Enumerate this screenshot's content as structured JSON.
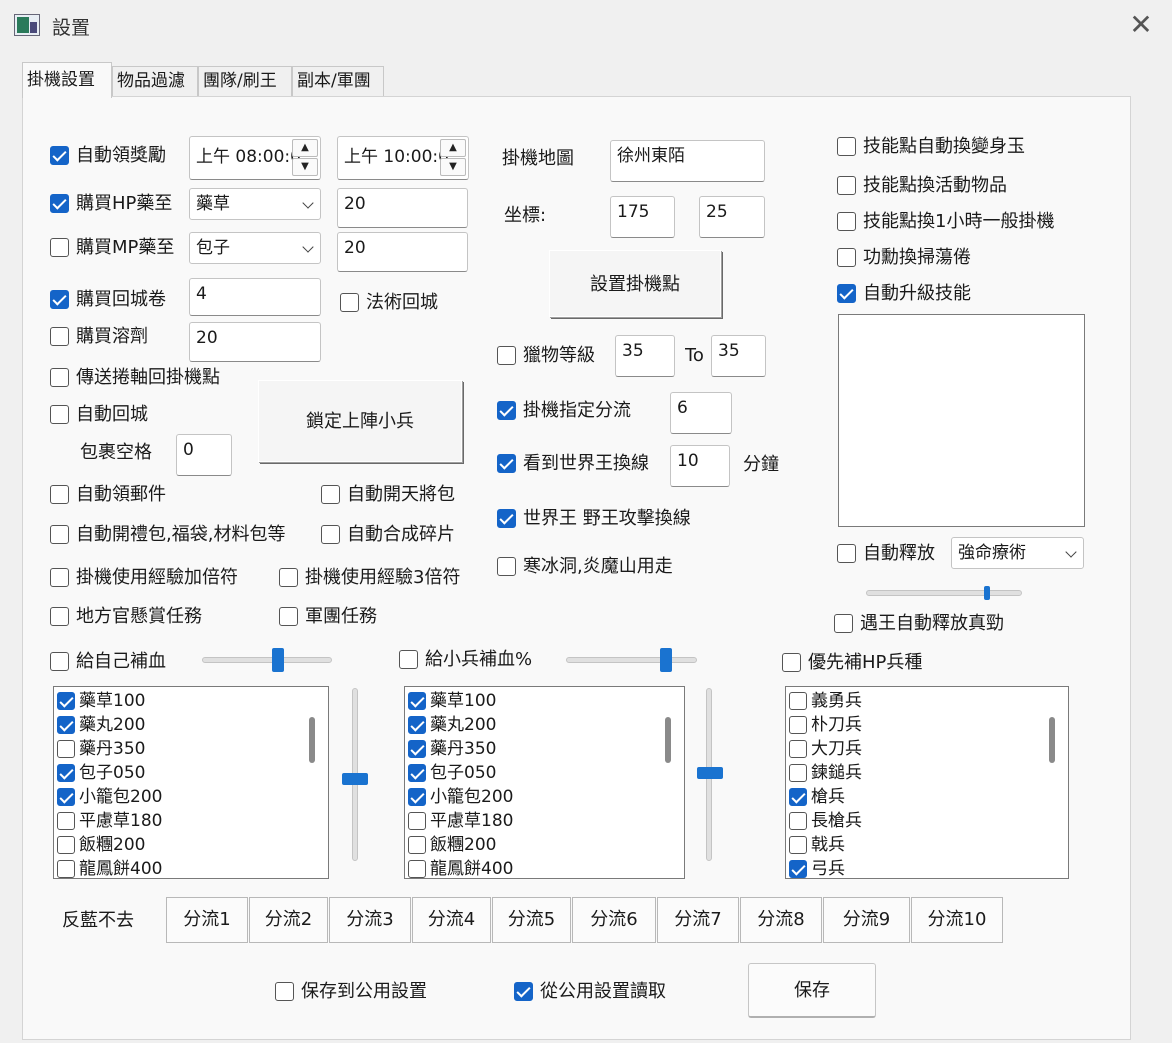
{
  "window": {
    "title": "設置",
    "close_symbol": "✕"
  },
  "tabs": [
    "掛機設置",
    "物品過濾",
    "團隊/刷王",
    "副本/軍團"
  ],
  "left": {
    "auto_reward": {
      "label": "自動領獎勵",
      "checked": true,
      "time_start": "上午 08:00:0",
      "time_end": "上午 10:00:0"
    },
    "buy_hp": {
      "label": "購買HP藥至",
      "checked": true,
      "item": "藥草",
      "qty": "20"
    },
    "buy_mp": {
      "label": "購買MP藥至",
      "checked": false,
      "item": "包子",
      "qty": "20"
    },
    "buy_return_scroll": {
      "label": "購買回城卷",
      "checked": true,
      "qty": "4"
    },
    "magic_return": {
      "label": "法術回城",
      "checked": false
    },
    "buy_solvent": {
      "label": "購買溶劑",
      "checked": false,
      "qty": "20"
    },
    "teleport_scroll": {
      "label": "傳送捲軸回掛機點",
      "checked": false
    },
    "lock_soldier_button": "鎖定上陣小兵",
    "auto_return": {
      "label": "自動回城",
      "checked": false
    },
    "bag_space": {
      "label": "包裹空格",
      "value": "0"
    },
    "auto_mail": {
      "label": "自動領郵件",
      "checked": false
    },
    "auto_open_general_pack": {
      "label": "自動開天將包",
      "checked": false
    },
    "auto_open_gift": {
      "label": "自動開禮包,福袋,材料包等",
      "checked": false
    },
    "auto_merge_fragments": {
      "label": "自動合成碎片",
      "checked": false
    },
    "use_exp_double": {
      "label": "掛機使用經驗加倍符",
      "checked": false
    },
    "use_exp_triple": {
      "label": "掛機使用經驗3倍符",
      "checked": false
    },
    "bounty_task": {
      "label": "地方官懸賞任務",
      "checked": false
    },
    "legion_task": {
      "label": "軍團任務",
      "checked": false
    }
  },
  "middle": {
    "map_label": "掛機地圖",
    "map_value": "徐州東陌",
    "coord_label": "坐標:",
    "coord_x": "175",
    "coord_y": "25",
    "set_point_button": "設置掛機點",
    "prey_level": {
      "label": "獵物等級",
      "checked": false,
      "from": "35",
      "to_label": "To",
      "to": "35"
    },
    "specify_line": {
      "label": "掛機指定分流",
      "checked": true,
      "value": "6"
    },
    "world_boss_switch": {
      "label": "看到世界王換線",
      "checked": true,
      "value": "10",
      "unit": "分鐘"
    },
    "boss_attack_switch": {
      "label": "世界王 野王攻擊換線",
      "checked": true
    },
    "cold_cave": {
      "label": "寒冰洞,炎魔山用走",
      "checked": false
    }
  },
  "right": {
    "skill_to_jade": {
      "label": "技能點自動換變身玉",
      "checked": false
    },
    "skill_to_event": {
      "label": "技能點換活動物品",
      "checked": false
    },
    "skill_to_1h": {
      "label": "技能點換1小時一般掛機",
      "checked": false
    },
    "merit_to_sweep": {
      "label": "功勳換掃蕩倦",
      "checked": false
    },
    "auto_upgrade_skill": {
      "label": "自動升級技能",
      "checked": true
    },
    "auto_release": {
      "label": "自動釋放",
      "checked": false,
      "skill": "強命療術"
    },
    "boss_release": {
      "label": "遇王自動釋放真勁",
      "checked": false
    }
  },
  "heal": {
    "self": {
      "label": "給自己補血",
      "checked": false,
      "level": 0.58
    },
    "soldier": {
      "label": "給小兵補血%",
      "checked": false,
      "level": 0.75
    },
    "priority": {
      "label": "優先補HP兵種",
      "checked": false
    },
    "potion_list_self": [
      {
        "name": "藥草100",
        "checked": true
      },
      {
        "name": "藥丸200",
        "checked": true
      },
      {
        "name": "藥丹350",
        "checked": false
      },
      {
        "name": "包子050",
        "checked": true
      },
      {
        "name": "小籠包200",
        "checked": true
      },
      {
        "name": "平慮草180",
        "checked": false
      },
      {
        "name": "飯糰200",
        "checked": false
      },
      {
        "name": "龍鳳餅400",
        "checked": false
      }
    ],
    "potion_list_soldier": [
      {
        "name": "藥草100",
        "checked": true
      },
      {
        "name": "藥丸200",
        "checked": true
      },
      {
        "name": "藥丹350",
        "checked": true
      },
      {
        "name": "包子050",
        "checked": true
      },
      {
        "name": "小籠包200",
        "checked": true
      },
      {
        "name": "平慮草180",
        "checked": false
      },
      {
        "name": "飯糰200",
        "checked": false
      },
      {
        "name": "龍鳳餅400",
        "checked": false
      }
    ],
    "soldier_types": [
      {
        "name": "義勇兵",
        "checked": false
      },
      {
        "name": "朴刀兵",
        "checked": false
      },
      {
        "name": "大刀兵",
        "checked": false
      },
      {
        "name": "鍊鎚兵",
        "checked": false
      },
      {
        "name": "槍兵",
        "checked": true
      },
      {
        "name": "長槍兵",
        "checked": false
      },
      {
        "name": "戟兵",
        "checked": false
      },
      {
        "name": "弓兵",
        "checked": true
      }
    ]
  },
  "footer": {
    "anti_blue_label": "反藍不去",
    "channels": [
      "分流1",
      "分流2",
      "分流3",
      "分流4",
      "分流5",
      "分流6",
      "分流7",
      "分流8",
      "分流9",
      "分流10"
    ],
    "save_public": {
      "label": "保存到公用設置",
      "checked": false
    },
    "load_public": {
      "label": "從公用設置讀取",
      "checked": true
    },
    "save_button": "保存"
  },
  "colors": {
    "accent": "#1464c8",
    "slider": "#1a73d0",
    "window_bg": "#f0f0f0",
    "panel_bg": "#f9f9f9"
  }
}
